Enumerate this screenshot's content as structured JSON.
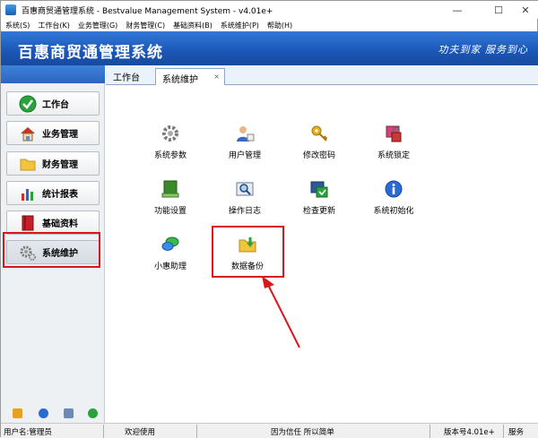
{
  "window": {
    "title": "百惠商贸通管理系统 - Bestvalue Management System - v4.01e+",
    "controls": {
      "minimize": "—",
      "maximize": "☐",
      "close": "✕"
    }
  },
  "menu": [
    "系统(S)",
    "工作台(K)",
    "业务管理(G)",
    "财务管理(C)",
    "基础资料(B)",
    "系统维护(P)",
    "帮助(H)"
  ],
  "banner": {
    "title": "百惠商贸通管理系统",
    "slogan": "功夫到家  服务到心"
  },
  "sidebar": {
    "items": [
      {
        "label": "工作台",
        "icon": "check-icon"
      },
      {
        "label": "业务管理",
        "icon": "house-icon"
      },
      {
        "label": "财务管理",
        "icon": "folder-icon"
      },
      {
        "label": "统计报表",
        "icon": "bar-chart-icon"
      },
      {
        "label": "基础资料",
        "icon": "book-icon"
      },
      {
        "label": "系统维护",
        "icon": "gears-icon"
      }
    ],
    "selected": "系统维护"
  },
  "tabs": [
    {
      "label": "工作台"
    },
    {
      "label": "系统维护",
      "close": "×"
    }
  ],
  "functions": [
    {
      "label": "系统参数",
      "icon": "gear-icon"
    },
    {
      "label": "用户管理",
      "icon": "user-icon"
    },
    {
      "label": "修改密码",
      "icon": "key-icon"
    },
    {
      "label": "系统锁定",
      "icon": "lock-icon"
    },
    {
      "label": "功能设置",
      "icon": "settings-book-icon"
    },
    {
      "label": "操作日志",
      "icon": "log-search-icon"
    },
    {
      "label": "检查更新",
      "icon": "update-icon"
    },
    {
      "label": "系统初始化",
      "icon": "info-icon"
    },
    {
      "label": "小惠助理",
      "icon": "chat-icon"
    },
    {
      "label": "数据备份",
      "icon": "backup-icon"
    }
  ],
  "status": {
    "user": "用户名:管理员",
    "welcome": "欢迎使用",
    "motto": "因为信任 所以简单",
    "version": "版本号4.01e+",
    "service": "服务"
  },
  "colors": {
    "banner": "#1b56b6",
    "highlight": "#d9161c"
  }
}
